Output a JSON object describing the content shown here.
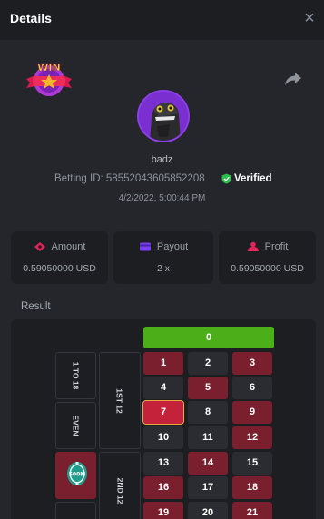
{
  "header": {
    "title": "Details"
  },
  "profile": {
    "win_badge_text": "WIN",
    "username": "badz",
    "betting_id_label": "Betting ID:",
    "betting_id": "58552043605852208",
    "verified_label": "Verified",
    "timestamp": "4/2/2022, 5:00:44 PM"
  },
  "stats": [
    {
      "label": "Amount",
      "value": "0.59050000 USD",
      "icon": "money-icon",
      "color": "#e3245a"
    },
    {
      "label": "Payout",
      "value": "2 x",
      "icon": "wallet-icon",
      "color": "#7a3ff0"
    },
    {
      "label": "Profit",
      "value": "0.59050000 USD",
      "icon": "profit-icon",
      "color": "#e3245a"
    }
  ],
  "result": {
    "label": "Result",
    "zero": "0",
    "rows": [
      [
        {
          "n": "1",
          "c": "red"
        },
        {
          "n": "2",
          "c": "black"
        },
        {
          "n": "3",
          "c": "red"
        }
      ],
      [
        {
          "n": "4",
          "c": "black"
        },
        {
          "n": "5",
          "c": "red"
        },
        {
          "n": "6",
          "c": "black"
        }
      ],
      [
        {
          "n": "7",
          "c": "selected"
        },
        {
          "n": "8",
          "c": "black"
        },
        {
          "n": "9",
          "c": "red"
        }
      ],
      [
        {
          "n": "10",
          "c": "black"
        },
        {
          "n": "11",
          "c": "black"
        },
        {
          "n": "12",
          "c": "red"
        }
      ],
      [
        {
          "n": "13",
          "c": "black"
        },
        {
          "n": "14",
          "c": "red"
        },
        {
          "n": "15",
          "c": "black"
        }
      ],
      [
        {
          "n": "16",
          "c": "red"
        },
        {
          "n": "17",
          "c": "black"
        },
        {
          "n": "18",
          "c": "red"
        }
      ],
      [
        {
          "n": "19",
          "c": "red"
        },
        {
          "n": "20",
          "c": "black"
        },
        {
          "n": "21",
          "c": "red"
        }
      ]
    ],
    "outside": {
      "one_to_18": "1 TO 18",
      "even": "EVEN",
      "first_12": "1ST 12",
      "second_12": "2ND 12",
      "chip_value": "500M"
    }
  },
  "colors": {
    "green": "#4caf1a",
    "red": "#7a1f2d",
    "accent": "#c4223a"
  }
}
